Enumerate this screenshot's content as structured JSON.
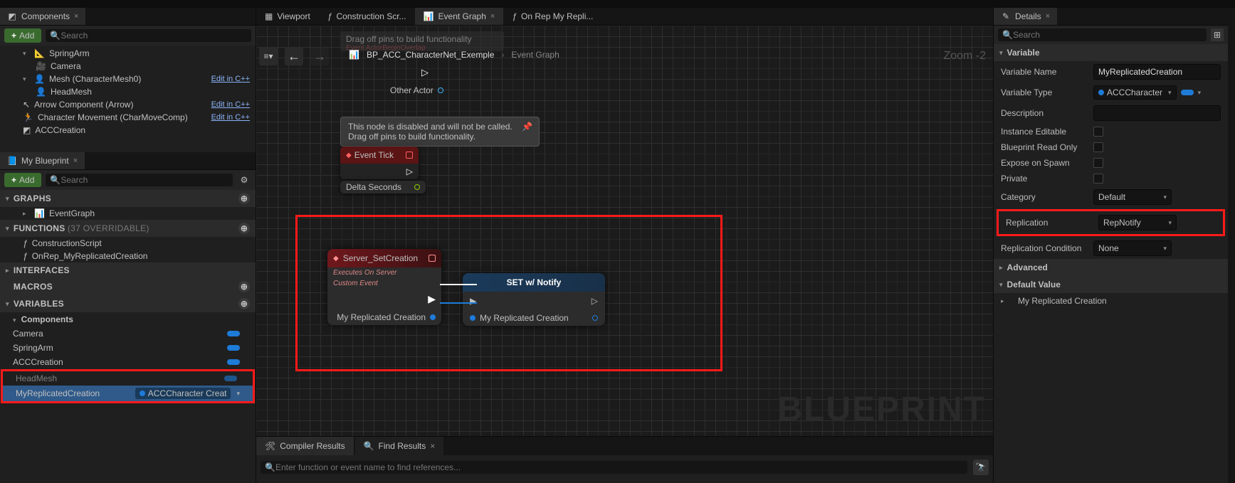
{
  "left": {
    "components_tab": "Components",
    "add": "Add",
    "search_placeholder": "Search",
    "tree": {
      "spring_arm": "SpringArm",
      "camera": "Camera",
      "mesh": "Mesh (CharacterMesh0)",
      "head_mesh": "HeadMesh",
      "arrow": "Arrow Component (Arrow)",
      "char_move": "Character Movement (CharMoveComp)",
      "acc_creation": "ACCCreation",
      "edit_cpp": "Edit in C++"
    },
    "myblueprint_tab": "My Blueprint",
    "sections": {
      "graphs": "GRAPHS",
      "functions": "FUNCTIONS",
      "functions_suffix": "(37 OVERRIDABLE)",
      "interfaces": "INTERFACES",
      "macros": "MACROS",
      "variables": "VARIABLES",
      "components_sub": "Components"
    },
    "graphs": {
      "event_graph": "EventGraph"
    },
    "functions": {
      "construction": "ConstructionScript",
      "onrep": "OnRep_MyReplicatedCreation"
    },
    "variables": {
      "camera": "Camera",
      "spring_arm": "SpringArm",
      "acc": "ACCCreation",
      "head": "HeadMesh",
      "selected": "MyReplicatedCreation",
      "selected_type": "ACCCharacter Creat"
    }
  },
  "center": {
    "tabs": {
      "viewport": "Viewport",
      "construction": "Construction Scr...",
      "event_graph": "Event Graph",
      "onrep": "On Rep My Repli..."
    },
    "breadcrumb": {
      "bp": "BP_ACC_CharacterNet_Exemple",
      "graph": "Event Graph"
    },
    "zoom": "Zoom -2",
    "faded_node": "Drag off pins to build functionality",
    "faded_node_sub": "Event ActorBeginOverlap",
    "other_actor": "Other Actor",
    "disabled_msg_1": "This node is disabled and will not be called.",
    "disabled_msg_2": "Drag off pins to build functionality.",
    "event_tick": "Event Tick",
    "delta_seconds": "Delta Seconds",
    "server_node": {
      "title": "Server_SetCreation",
      "sub1": "Executes On Server",
      "sub2": "Custom Event",
      "out_pin": "My Replicated Creation"
    },
    "set_node": {
      "title": "SET w/ Notify",
      "in_pin": "My Replicated Creation"
    },
    "watermark": "BLUEPRINT",
    "bottom_tabs": {
      "compiler": "Compiler Results",
      "find": "Find Results"
    },
    "bottom_search_placeholder": "Enter function or event name to find references..."
  },
  "right": {
    "details_tab": "Details",
    "search_placeholder": "Search",
    "sections": {
      "variable": "Variable",
      "advanced": "Advanced",
      "default_value": "Default Value"
    },
    "props": {
      "var_name_label": "Variable Name",
      "var_name_value": "MyReplicatedCreation",
      "var_type_label": "Variable Type",
      "var_type_value": "ACCCharacter",
      "description_label": "Description",
      "instance_editable": "Instance Editable",
      "bp_read_only": "Blueprint Read Only",
      "expose_spawn": "Expose on Spawn",
      "private": "Private",
      "category_label": "Category",
      "category_value": "Default",
      "replication_label": "Replication",
      "replication_value": "RepNotify",
      "rep_cond_label": "Replication Condition",
      "rep_cond_value": "None",
      "default_row": "My Replicated Creation"
    }
  }
}
